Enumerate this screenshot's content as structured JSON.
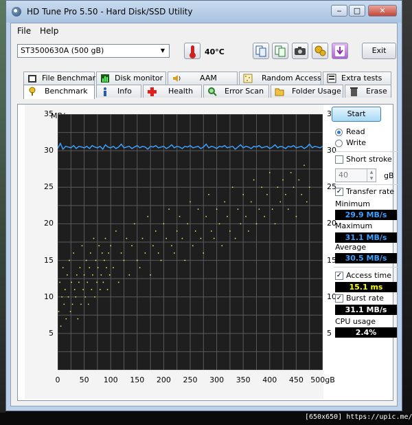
{
  "window": {
    "title": "HD Tune Pro 5.50 - Hard Disk/SSD Utility",
    "minimize": "‒",
    "maximize": "□",
    "close": "✕"
  },
  "menu": {
    "file": "File",
    "help": "Help"
  },
  "toolbar": {
    "drive": "ST3500630A (500 gB)",
    "temperature": "40°C",
    "exit": "Exit"
  },
  "tabs_top": [
    {
      "label": "File Benchmark",
      "icon": "file-benchmark-icon"
    },
    {
      "label": "Disk monitor",
      "icon": "disk-monitor-icon"
    },
    {
      "label": "AAM",
      "icon": "speaker-icon"
    },
    {
      "label": "Random Access",
      "icon": "random-access-icon"
    },
    {
      "label": "Extra tests",
      "icon": "extra-tests-icon"
    }
  ],
  "tabs_bottom": [
    {
      "label": "Benchmark",
      "icon": "benchmark-icon",
      "active": true
    },
    {
      "label": "Info",
      "icon": "info-icon"
    },
    {
      "label": "Health",
      "icon": "health-cross-icon"
    },
    {
      "label": "Error Scan",
      "icon": "magnifier-icon"
    },
    {
      "label": "Folder Usage",
      "icon": "folder-icon"
    },
    {
      "label": "Erase",
      "icon": "trash-icon"
    }
  ],
  "side": {
    "start": "Start",
    "read": "Read",
    "write": "Write",
    "short_stroke": "Short stroke",
    "short_stroke_value": "40",
    "short_stroke_unit": "gB",
    "transfer_rate": "Transfer rate",
    "minimum_label": "Minimum",
    "minimum": "29.9 MB/s",
    "maximum_label": "Maximum",
    "maximum": "31.1 MB/s",
    "average_label": "Average",
    "average": "30.5 MB/s",
    "access_time_label": "Access time",
    "access_time": "15.1 ms",
    "burst_rate_label": "Burst rate",
    "burst_rate": "31.1 MB/s",
    "cpu_label": "CPU usage",
    "cpu": "2.4%"
  },
  "colors": {
    "blue_value": "#3ea0ff",
    "yellow_value": "#ffff00",
    "white_value": "#ffffff",
    "transfer_line": "#3ea0ff",
    "access_points": "#e8e860"
  },
  "chart_data": {
    "type": "line",
    "xlabel": "",
    "x_unit": "gB",
    "ylabel_left": "MB/s",
    "ylabel_right": "ms",
    "xlim": [
      0,
      500
    ],
    "ylim": [
      0,
      35
    ],
    "x_ticks": [
      "0",
      "50",
      "100",
      "150",
      "200",
      "250",
      "300",
      "350",
      "400",
      "450",
      "500gB"
    ],
    "y_ticks": [
      "5",
      "10",
      "15",
      "20",
      "25",
      "30",
      "35"
    ],
    "grid": true,
    "series": [
      {
        "x": [
          0,
          5,
          10,
          15,
          20,
          25,
          30,
          35,
          40,
          45,
          50,
          55,
          60,
          65,
          70,
          75,
          80,
          85,
          90,
          95,
          100,
          105,
          110,
          115,
          120,
          125,
          130,
          135,
          140,
          145,
          150,
          155,
          160,
          165,
          170,
          175,
          180,
          185,
          190,
          195,
          200,
          205,
          210,
          215,
          220,
          225,
          230,
          235,
          240,
          245,
          250,
          255,
          260,
          265,
          270,
          275,
          280,
          285,
          290,
          295,
          300,
          305,
          310,
          315,
          320,
          325,
          330,
          335,
          340,
          345,
          350,
          355,
          360,
          365,
          370,
          375,
          380,
          385,
          390,
          395,
          400,
          405,
          410,
          415,
          420,
          425,
          430,
          435,
          440,
          445,
          450,
          455,
          460,
          465,
          470,
          475,
          480,
          485,
          490,
          495,
          500
        ],
        "values": [
          30.3,
          31.0,
          30.2,
          30.6,
          30.5,
          30.4,
          30.7,
          30.3,
          30.6,
          30.5,
          30.4,
          30.6,
          30.3,
          30.7,
          30.5,
          30.4,
          30.6,
          30.2,
          30.8,
          30.5,
          30.4,
          30.6,
          30.3,
          30.5,
          30.9,
          30.4,
          30.5,
          30.6,
          30.3,
          30.5,
          30.7,
          30.4,
          30.6,
          30.5,
          30.2,
          30.6,
          30.5,
          30.7,
          30.4,
          30.5,
          30.6,
          30.3,
          30.5,
          30.8,
          30.4,
          30.6,
          30.5,
          30.3,
          30.6,
          30.5,
          30.7,
          30.4,
          30.5,
          30.6,
          30.3,
          30.5,
          30.9,
          30.4,
          30.6,
          30.5,
          30.3,
          30.6,
          30.5,
          30.7,
          30.4,
          30.5,
          30.6,
          30.2,
          30.5,
          30.8,
          30.4,
          30.6,
          30.5,
          30.3,
          30.6,
          30.5,
          30.7,
          30.4,
          30.5,
          30.6,
          30.3,
          30.5,
          30.8,
          30.4,
          30.6,
          30.5,
          30.3,
          30.6,
          30.5,
          30.7,
          30.4,
          30.5,
          30.6,
          30.3,
          30.5,
          30.9,
          30.4,
          30.6,
          30.5,
          30.4,
          30.6
        ]
      },
      {
        "type": "scatter",
        "range_description_ms": [
          5,
          28
        ],
        "x": [
          2,
          4,
          6,
          8,
          10,
          12,
          14,
          16,
          18,
          20,
          22,
          24,
          26,
          28,
          30,
          32,
          34,
          36,
          38,
          40,
          42,
          44,
          46,
          48,
          50,
          52,
          54,
          56,
          58,
          60,
          62,
          64,
          66,
          68,
          70,
          72,
          74,
          76,
          78,
          80,
          82,
          84,
          86,
          88,
          90,
          92,
          94,
          96,
          98,
          100,
          105,
          110,
          115,
          120,
          125,
          130,
          135,
          140,
          145,
          150,
          155,
          160,
          165,
          170,
          175,
          180,
          185,
          190,
          195,
          200,
          205,
          210,
          215,
          220,
          225,
          230,
          235,
          240,
          245,
          250,
          255,
          260,
          265,
          270,
          275,
          280,
          285,
          290,
          295,
          300,
          305,
          310,
          315,
          320,
          325,
          330,
          335,
          340,
          345,
          350,
          355,
          360,
          365,
          370,
          375,
          380,
          385,
          390,
          395,
          400,
          405,
          410,
          415,
          420,
          425,
          430,
          435,
          440,
          445,
          450,
          455,
          460,
          465,
          470,
          475
        ],
        "values": [
          8,
          12,
          6,
          10,
          14,
          9,
          11,
          7,
          13,
          10,
          15,
          8,
          12,
          9,
          16,
          11,
          10,
          13,
          7,
          12,
          14,
          9,
          17,
          11,
          13,
          10,
          15,
          12,
          9,
          14,
          16,
          11,
          13,
          18,
          10,
          15,
          12,
          14,
          17,
          11,
          13,
          16,
          12,
          15,
          18,
          14,
          11,
          16,
          13,
          17,
          14,
          19,
          12,
          16,
          15,
          18,
          13,
          17,
          20,
          15,
          14,
          18,
          16,
          21,
          13,
          17,
          19,
          16,
          15,
          20,
          18,
          22,
          17,
          16,
          19,
          21,
          18,
          15,
          20,
          23,
          17,
          19,
          22,
          18,
          16,
          21,
          24,
          19,
          18,
          22,
          20,
          17,
          23,
          21,
          19,
          25,
          18,
          22,
          20,
          24,
          21,
          19,
          23,
          26,
          20,
          22,
          25,
          21,
          24,
          27,
          22,
          20,
          25,
          23,
          26,
          24,
          22,
          27,
          25,
          21,
          26,
          24,
          28,
          23,
          25
        ]
      }
    ]
  }
}
